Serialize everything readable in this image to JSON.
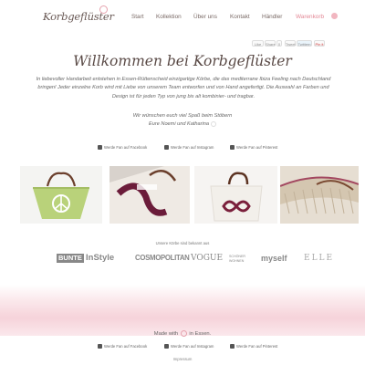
{
  "header": {
    "logo": "Korbgeflüster",
    "nav": [
      "Start",
      "Kollektion",
      "Über uns",
      "Kontakt",
      "Händler",
      "Warenkorb"
    ]
  },
  "social_top": [
    "Like",
    "Share",
    "0",
    "Tweet",
    "Twittern",
    "Pin it"
  ],
  "main": {
    "title": "Willkommen bei Korbgeflüster",
    "intro": "In liebevoller Handarbeit entstehen in Essen-Rüttenscheid einzigartige Körbe, die das mediterrane Ibiza Feeling nach Deutschland bringen! Jeder einzelne Korb wird mit Liebe von unserem Team entworfen und von Hand angefertigt. Die Auswahl an Farben und Design ist für jeden Typ von jung bis alt kombinier- und tragbar.",
    "greeting_line1": "Wir wünschen euch viel Spaß beim Stöbern",
    "greeting_line2": "Eure Noemi und Katharina",
    "follow": [
      "Werde Fan auf Facebook",
      "Werde Fan auf Instagram",
      "Werde Fan auf Pinterest"
    ]
  },
  "photos": [
    "green basket with peace sign",
    "bag with purple print",
    "white bag with infinity sign",
    "woven basket detail"
  ],
  "press": {
    "label": "Unsere Körbe sind bekannt aus",
    "logos": [
      "BUNTE",
      "InStyle",
      "COSMOPOLITAN",
      "VOGUE",
      "SCHÖNER WOHNEN",
      "myself",
      "ELLE"
    ]
  },
  "footer": {
    "made_prefix": "Made with",
    "made_suffix": "in Essen.",
    "follow": [
      "Werde Fan auf Facebook",
      "Werde Fan auf Instagram",
      "Werde Fan auf Pinterest"
    ],
    "imprint": "Impressum"
  },
  "colors": {
    "accent_pink": "#e38795",
    "text": "#555555",
    "band_pink": "#f6d3da"
  }
}
